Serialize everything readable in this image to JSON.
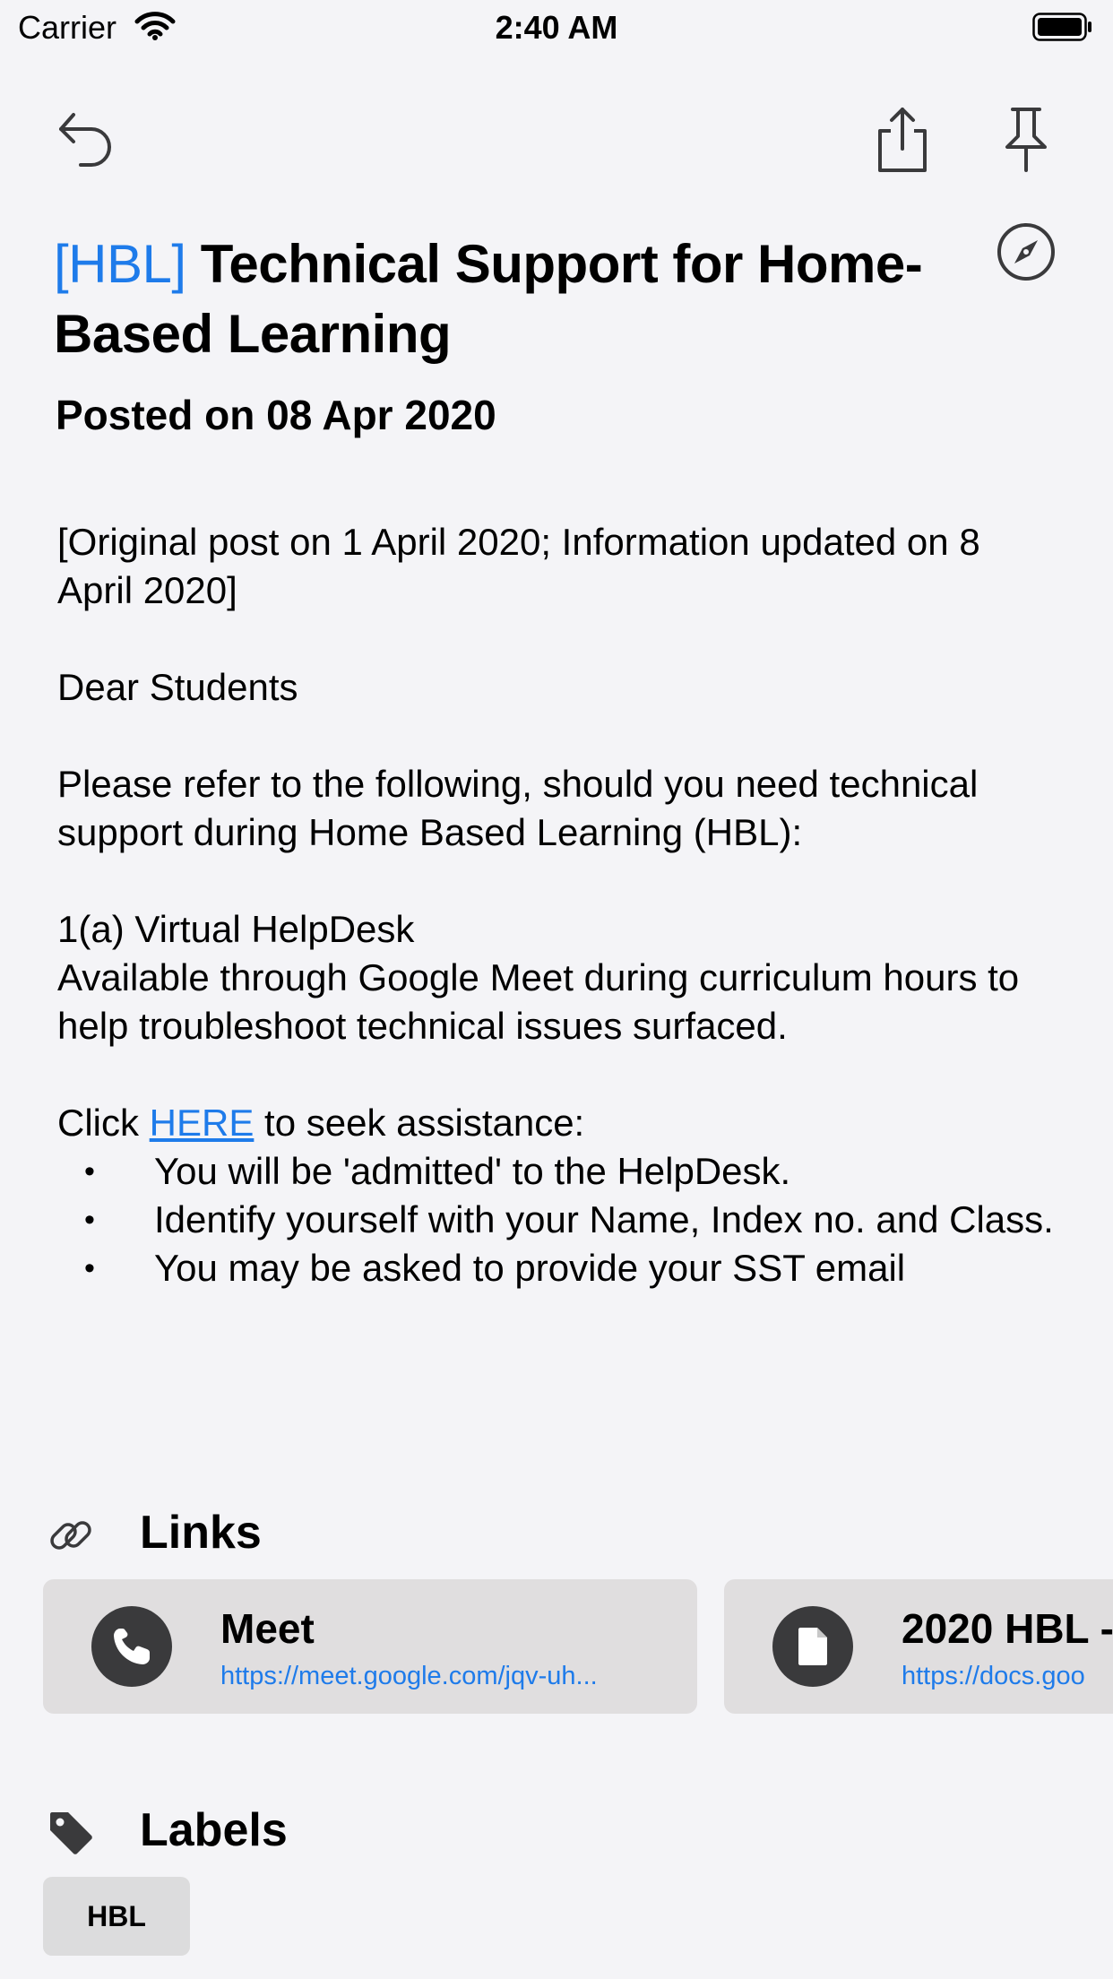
{
  "status_bar": {
    "carrier": "Carrier",
    "time": "2:40 AM"
  },
  "toolbar": {
    "back_icon": "undo-arrow-icon",
    "share_icon": "share-icon",
    "pin_icon": "pushpin-icon",
    "browser_icon": "compass-icon"
  },
  "post": {
    "tag": "[HBL]",
    "title": " Technical Support for Home-Based Learning",
    "posted": "Posted on 08 Apr 2020",
    "paragraphs": {
      "note": "[Original post on 1 April 2020; Information updated on 8 April 2020]",
      "greeting": "Dear Students",
      "intro": "Please refer to the following, should you need technical support during Home Based Learning (HBL):",
      "helpdesk_heading": "1(a) Virtual HelpDesk",
      "helpdesk_desc": "Available through Google Meet during curriculum hours to help troubleshoot technical issues surfaced.",
      "click_prefix": "Click ",
      "click_link": "HERE",
      "click_suffix": " to seek assistance:"
    },
    "bullets": [
      "You will be 'admitted' to the HelpDesk.",
      "Identify yourself with your Name, Index no. and Class.",
      "You may be asked to provide your SST email"
    ]
  },
  "links": {
    "heading": "Links",
    "icon": "link-icon",
    "items": [
      {
        "name": "Meet",
        "url": "https://meet.google.com/jqv-uh...",
        "icon": "phone-icon"
      },
      {
        "name": "2020 HBL -",
        "url": "https://docs.goo",
        "icon": "document-icon"
      }
    ]
  },
  "labels": {
    "heading": "Labels",
    "icon": "tag-icon",
    "items": [
      "HBL"
    ]
  },
  "colors": {
    "accent": "#1e7bea",
    "background": "#f4f4f7",
    "card": "#e0dedf",
    "chip": "#dcdcdd",
    "icon_dark": "#3a3a3c"
  }
}
